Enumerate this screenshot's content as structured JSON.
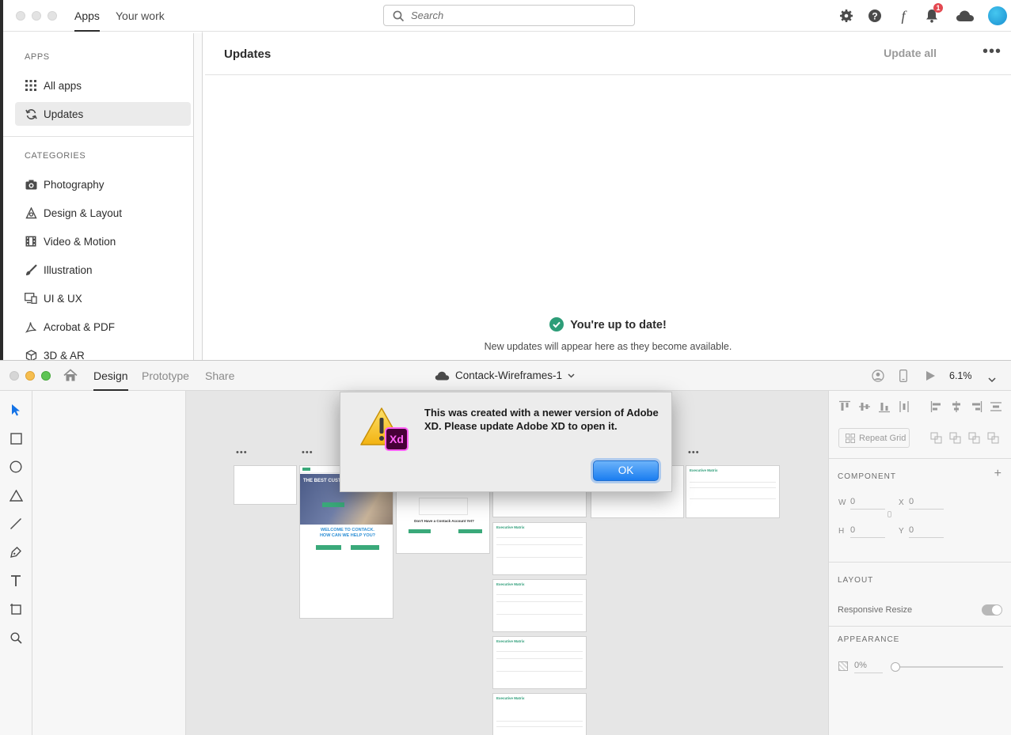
{
  "cc": {
    "tabs": [
      {
        "label": "Apps"
      },
      {
        "label": "Your work"
      }
    ],
    "search": {
      "placeholder": "Search"
    },
    "notifications": {
      "count": "1"
    },
    "sidebar": {
      "apps_heading": "APPS",
      "apps_items": [
        {
          "label": "All apps",
          "icon": "grid-icon"
        },
        {
          "label": "Updates",
          "icon": "refresh-icon"
        }
      ],
      "categories_heading": "CATEGORIES",
      "categories": [
        {
          "label": "Photography",
          "icon": "camera-icon"
        },
        {
          "label": "Design & Layout",
          "icon": "design-icon"
        },
        {
          "label": "Video & Motion",
          "icon": "film-icon"
        },
        {
          "label": "Illustration",
          "icon": "brush-icon"
        },
        {
          "label": "UI & UX",
          "icon": "devices-icon"
        },
        {
          "label": "Acrobat & PDF",
          "icon": "acrobat-icon"
        },
        {
          "label": "3D & AR",
          "icon": "cube-icon"
        }
      ]
    },
    "main": {
      "title": "Updates",
      "update_all": "Update all",
      "status_title": "You're up to date!",
      "status_sub": "New updates will appear here as they become available."
    },
    "accent": "#2d9d78"
  },
  "xd": {
    "tabs": [
      {
        "label": "Design"
      },
      {
        "label": "Prototype"
      },
      {
        "label": "Share"
      }
    ],
    "document_title": "Contack-Wireframes-1",
    "zoom": "6.1%",
    "props": {
      "repeat_grid": "Repeat Grid",
      "component_heading": "COMPONENT",
      "w_label": "W",
      "w_value": "0",
      "x_label": "X",
      "x_value": "0",
      "h_label": "H",
      "h_value": "0",
      "y_label": "Y",
      "y_value": "0",
      "layout_heading": "LAYOUT",
      "responsive_resize": "Responsive Resize",
      "appearance_heading": "APPEARANCE",
      "opacity": "0%"
    },
    "canvas": {
      "hero_text": "THE BEST CUSTOM",
      "welcome_text": "WELCOME TO CONTACK. HOW CAN WE HELP YOU?",
      "signup_text": "Don't Have a Contack Account Yet?",
      "board_title": "Executive Matrix"
    }
  },
  "dialog": {
    "message": "This was created with a newer version of Adobe XD. Please update Adobe XD to open it.",
    "ok_label": "OK",
    "app_badge": "Xd"
  }
}
